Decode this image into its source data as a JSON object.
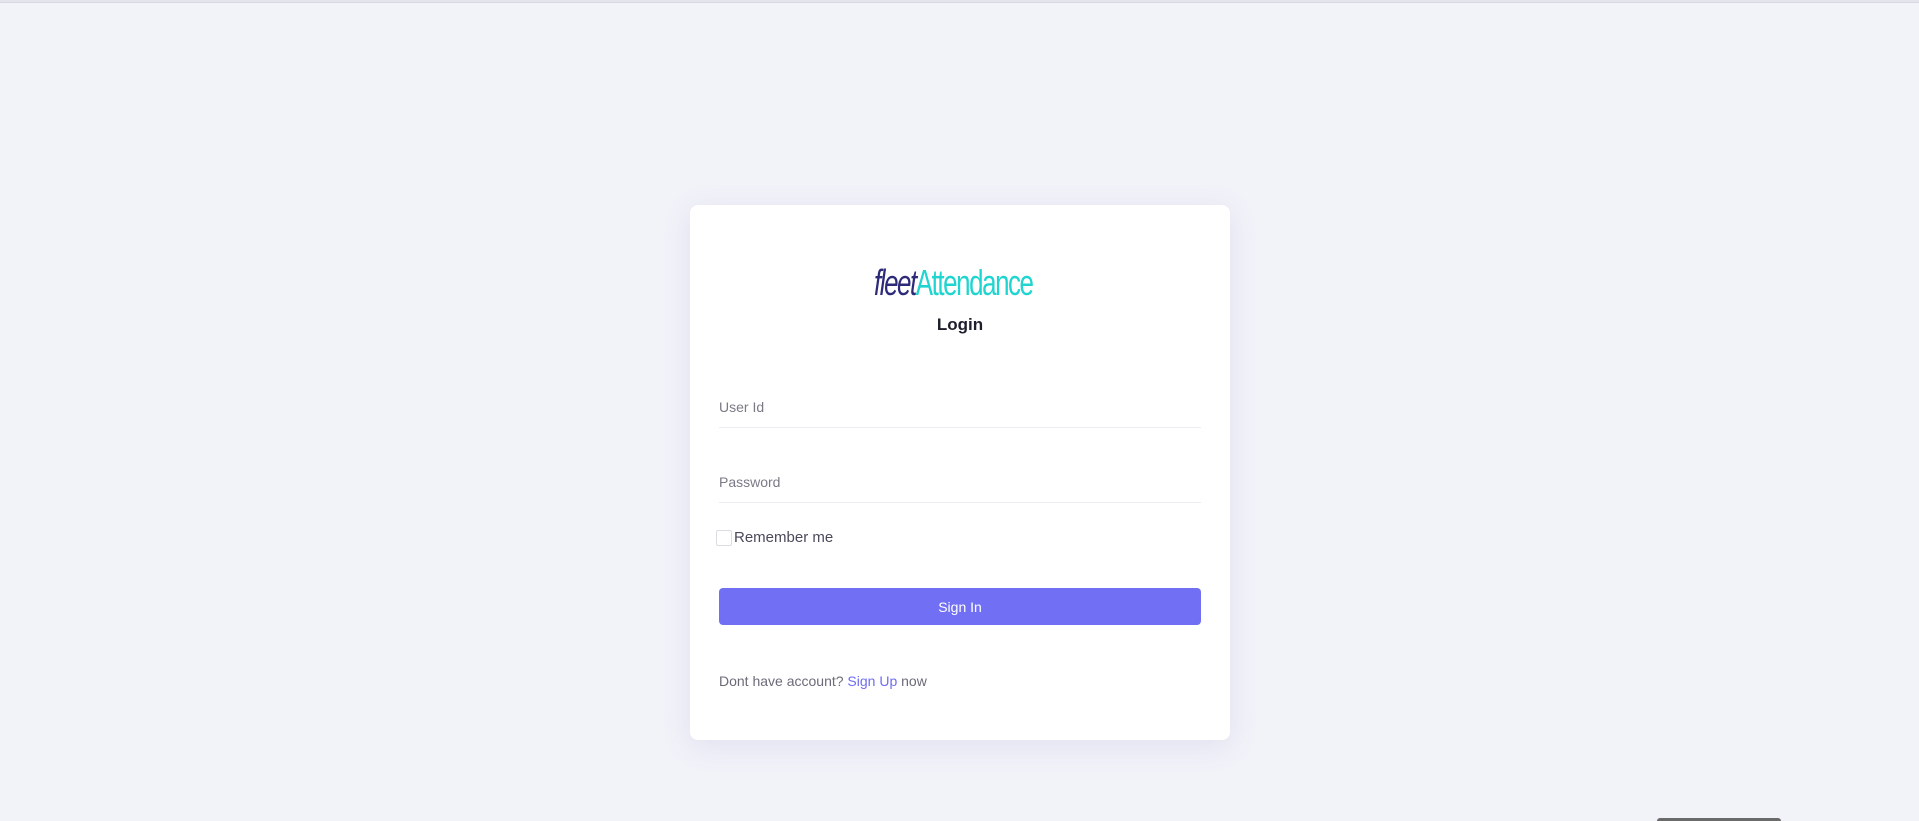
{
  "logo": {
    "word1": "fleet",
    "word2": "Attendance",
    "icon": "fingerprint-hand-icon",
    "colors": {
      "dark": "#2d2a7a",
      "accent": "#20d4cf"
    }
  },
  "login": {
    "title": "Login",
    "user_id_placeholder": "User Id",
    "password_placeholder": "Password",
    "remember_label": "Remember me",
    "remember_checked": false,
    "sign_in_label": "Sign In"
  },
  "signup": {
    "prefix": "Dont have account?",
    "link_label": "Sign Up",
    "suffix": "now"
  },
  "colors": {
    "background": "#f2f2f9",
    "primary": "#7170f5",
    "link": "#6e6cf0"
  }
}
